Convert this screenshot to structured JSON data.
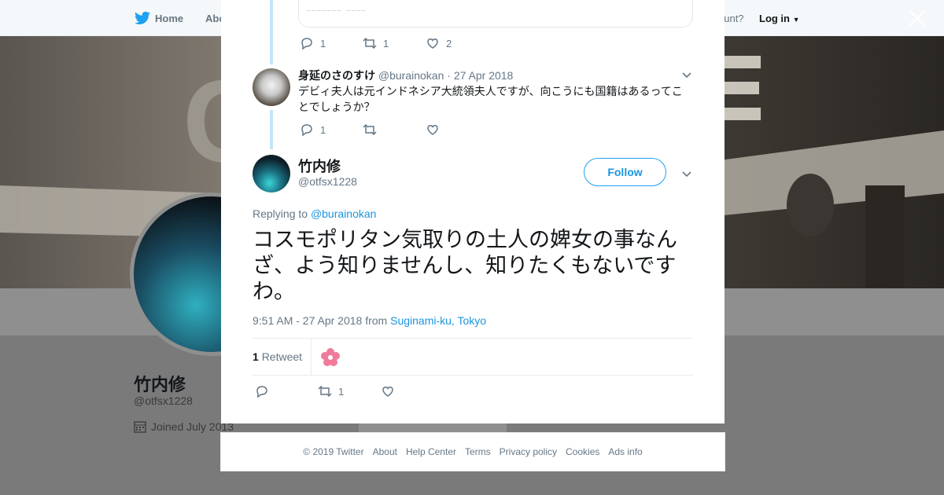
{
  "background": {
    "nav": {
      "home": "Home",
      "about": "Abo",
      "account_prompt": "ccount?",
      "login": "Log in"
    },
    "profile": {
      "name": "竹内修",
      "handle": "@otfsx1228",
      "joined": "Joined July 2013"
    },
    "banner_glyph": "C"
  },
  "modal": {
    "prev_tweet_actions": {
      "replies": "1",
      "retweets": "1",
      "likes": "2"
    },
    "reply_tweet": {
      "name": "身延のさのすけ",
      "handle": "@burainokan",
      "date": "· 27 Apr 2018",
      "text": "デビィ夫人は元インドネシア大統領夫人ですが、向こうにも国籍はあるってことでしょうか？",
      "actions": {
        "replies": "1",
        "retweets": "",
        "likes": ""
      }
    },
    "main_tweet": {
      "name": "竹内修",
      "handle": "@otfsx1228",
      "follow_label": "Follow",
      "replying_prefix": "Replying to",
      "replying_to": "@burainokan",
      "text": "コスモポリタン気取りの土人の婢女の事なんざ、よう知りませんし、知りたくもないですわ。",
      "time": "9:51 AM - 27 Apr 2018 from",
      "location": "Suginami-ku, Tokyo",
      "retweet_count": "1",
      "retweet_label": "Retweet",
      "actions": {
        "replies": "",
        "retweets": "1",
        "likes": ""
      }
    }
  },
  "footer": {
    "links": [
      "© 2019 Twitter",
      "About",
      "Help Center",
      "Terms",
      "Privacy policy",
      "Cookies",
      "Ads info"
    ]
  },
  "colors": {
    "accent": "#1da1f2",
    "link": "#1b95e0",
    "muted": "#657786",
    "thread": "#c4e6f9"
  }
}
